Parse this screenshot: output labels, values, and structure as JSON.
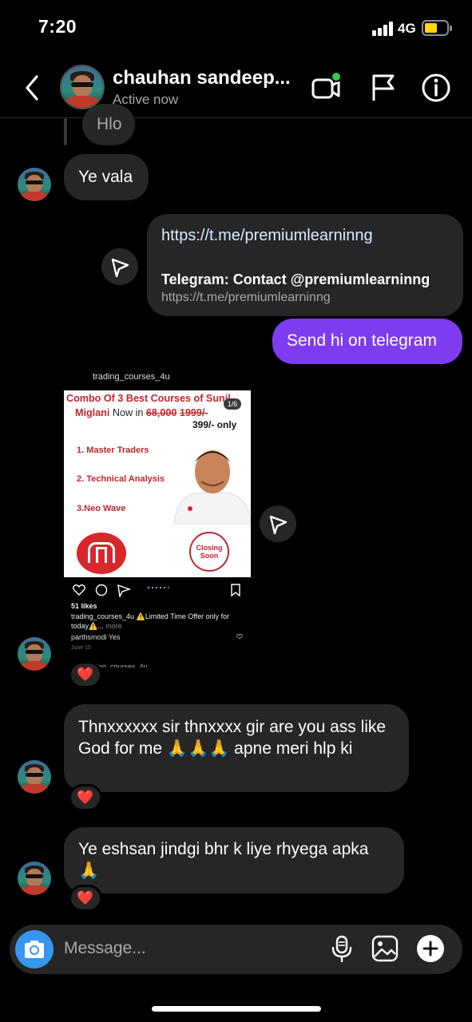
{
  "status_bar": {
    "time": "7:20",
    "network": "4G"
  },
  "header": {
    "name": "chauhan sandeep...",
    "status": "Active now",
    "icons": [
      "back-chevron-icon",
      "video-call-icon",
      "flag-icon",
      "info-icon"
    ],
    "online_dot_color": "#34c759"
  },
  "messages": {
    "partial_reply": "Hlo",
    "ye_vala": "Ye vala",
    "link_url": "https://t.me/premiumlearninng",
    "link_title": "Telegram: Contact @premiumlearninng",
    "link_subtitle": "https://t.me/premiumlearninng",
    "outgoing": "Send hi on telegram",
    "thanks": "Thnxxxxxx sir thnxxxx gir are you ass like God for me 🙏🙏🙏 apne meri hlp ki",
    "gratitude": "Ye eshsan jindgi bhr k liye rhyega apka 🙏",
    "reaction": "❤️"
  },
  "shared_post": {
    "header_user": "trading_courses_4u",
    "title_line1": "Combo Of 3 Best Courses of Sunil",
    "title_line2_name": "Miglani",
    "title_line2_now": "Now in",
    "old_price": "68,000",
    "old_price2": "1999/-",
    "emoji": "😱😨",
    "price": "399/- only",
    "page_badge": "1/6",
    "items": [
      "1. Master Traders",
      "2. Technical Analysis",
      "3.Neo Wave"
    ],
    "logo_text": "SM",
    "closing": "Closing Soon",
    "likes": "51 likes",
    "caption_user": "trading_courses_4u",
    "caption": "⚠️Limited Time Offer only for today⚠️...",
    "more": "more",
    "comment_user": "parthsmodi",
    "comment": "Yes",
    "date": "June 15",
    "next_user": "ding_courses_4u"
  },
  "composer": {
    "placeholder": "Message...",
    "icons": [
      "camera-icon",
      "microphone-icon",
      "gallery-icon",
      "plus-icon"
    ]
  },
  "colors": {
    "accent_blue": "#3797f0",
    "outgoing_purple": "#7d3cf0",
    "bubble_gray": "#262626",
    "battery_yellow": "#ffd60a"
  }
}
